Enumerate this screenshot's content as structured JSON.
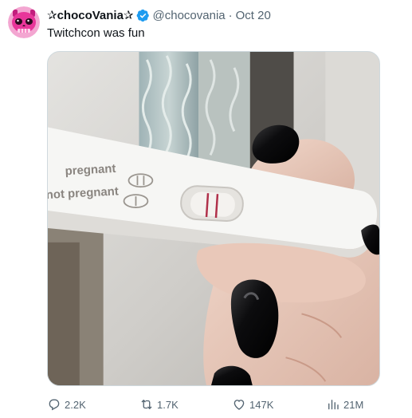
{
  "tweet": {
    "display_name": "✰chocoVania✰",
    "handle": "@chocovania",
    "separator": "·",
    "date": "Oct 20",
    "text": "Twitchcon was fun",
    "media": {
      "test_label_pregnant": "pregnant",
      "test_label_not_pregnant": "not pregnant"
    }
  },
  "actions": {
    "replies": "2.2K",
    "retweets": "1.7K",
    "likes": "147K",
    "views": "21M"
  },
  "icons": {
    "avatar": "pink-skull-avatar-icon",
    "verified": "verified-badge-icon",
    "reply": "reply-icon",
    "retweet": "retweet-icon",
    "like": "heart-icon",
    "views": "views-bar-chart-icon"
  },
  "colors": {
    "verified": "#1d9bf0",
    "text_primary": "#0f1419",
    "text_secondary": "#536471",
    "avatar_pink": "#e8369a"
  }
}
